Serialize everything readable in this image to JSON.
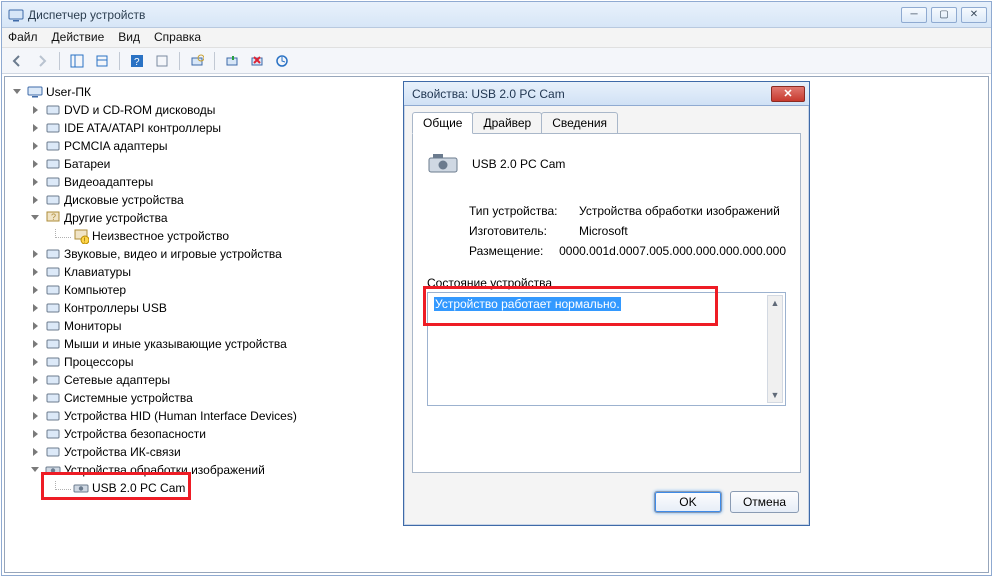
{
  "window": {
    "title": "Диспетчер устройств",
    "menu": {
      "file": "Файл",
      "action": "Действие",
      "view": "Вид",
      "help": "Справка"
    }
  },
  "tree": {
    "root": "User-ПК",
    "nodes": [
      "DVD и CD-ROM дисководы",
      "IDE ATA/ATAPI контроллеры",
      "PCMCIA адаптеры",
      "Батареи",
      "Видеоадаптеры",
      "Дисковые устройства"
    ],
    "other_devices": "Другие устройства",
    "unknown_device": "Неизвестное устройство",
    "nodes2": [
      "Звуковые, видео и игровые устройства",
      "Клавиатуры",
      "Компьютер",
      "Контроллеры USB",
      "Мониторы",
      "Мыши и иные указывающие устройства",
      "Процессоры",
      "Сетевые адаптеры",
      "Системные устройства",
      "Устройства HID (Human Interface Devices)",
      "Устройства безопасности",
      "Устройства ИК-связи"
    ],
    "imaging": "Устройства обработки изображений",
    "camera": "USB 2.0 PC Cam"
  },
  "dialog": {
    "title": "Свойства: USB 2.0 PC Cam",
    "tabs": {
      "general": "Общие",
      "driver": "Драйвер",
      "details": "Сведения"
    },
    "device_name": "USB 2.0 PC Cam",
    "rows": {
      "type_k": "Тип устройства:",
      "type_v": "Устройства обработки изображений",
      "mfr_k": "Изготовитель:",
      "mfr_v": "Microsoft",
      "loc_k": "Размещение:",
      "loc_v": "0000.001d.0007.005.000.000.000.000.000"
    },
    "status_group": "Состояние устройства",
    "status_text": "Устройство работает нормально.",
    "ok": "OK",
    "cancel": "Отмена"
  }
}
